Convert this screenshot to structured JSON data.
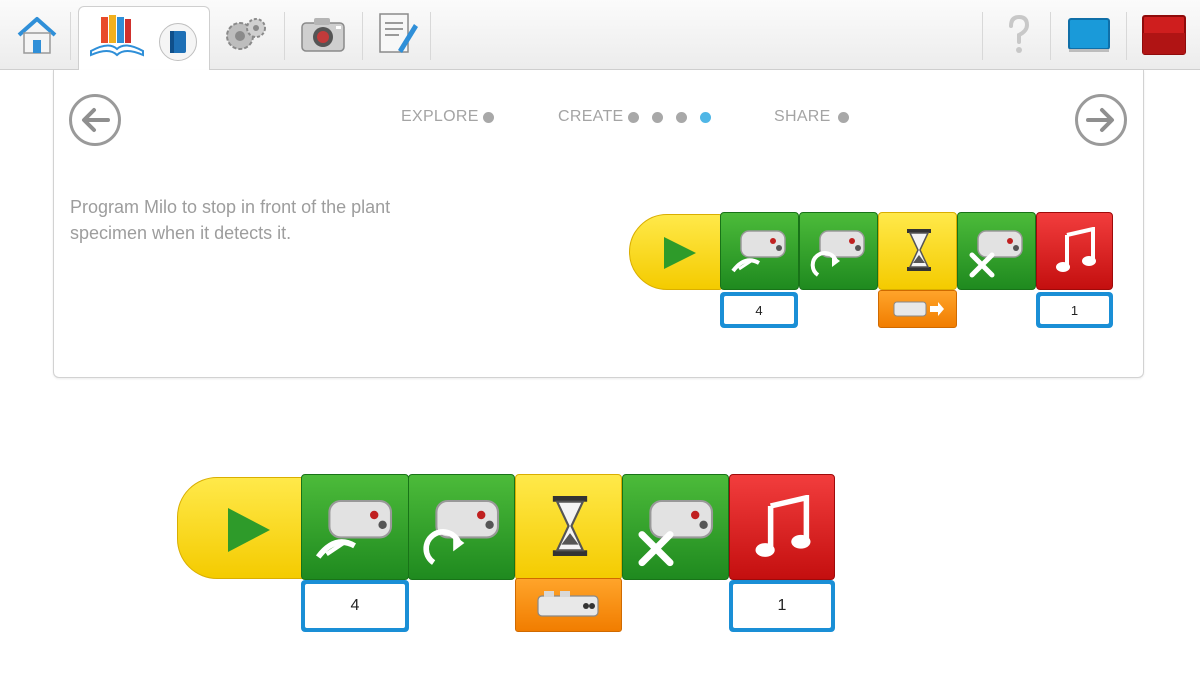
{
  "toolbar": {
    "buttons": [
      "home-icon",
      "library-icon",
      "book-icon",
      "gears-icon",
      "camera-icon",
      "document-edit-icon",
      "help-icon",
      "blue-screen-icon",
      "red-stop-icon"
    ]
  },
  "progress": {
    "explore": "EXPLORE",
    "create": "CREATE",
    "share": "SHARE",
    "create_dots": 4,
    "active_step": 4
  },
  "instruction": {
    "text": "Program Milo to stop in front of the plant specimen when it detects it."
  },
  "program_small": {
    "motor_power_value": "4",
    "sound_value": "1"
  },
  "program_large": {
    "motor_power_value": "4",
    "sound_value": "1"
  },
  "colors": {
    "accent_blue": "#4fb6e6",
    "block_green": "#2ea12b",
    "block_yellow": "#fbdc1f",
    "block_red": "#d91f1f",
    "input_blue": "#1a8fd6",
    "sensor_orange": "#f58e12"
  }
}
